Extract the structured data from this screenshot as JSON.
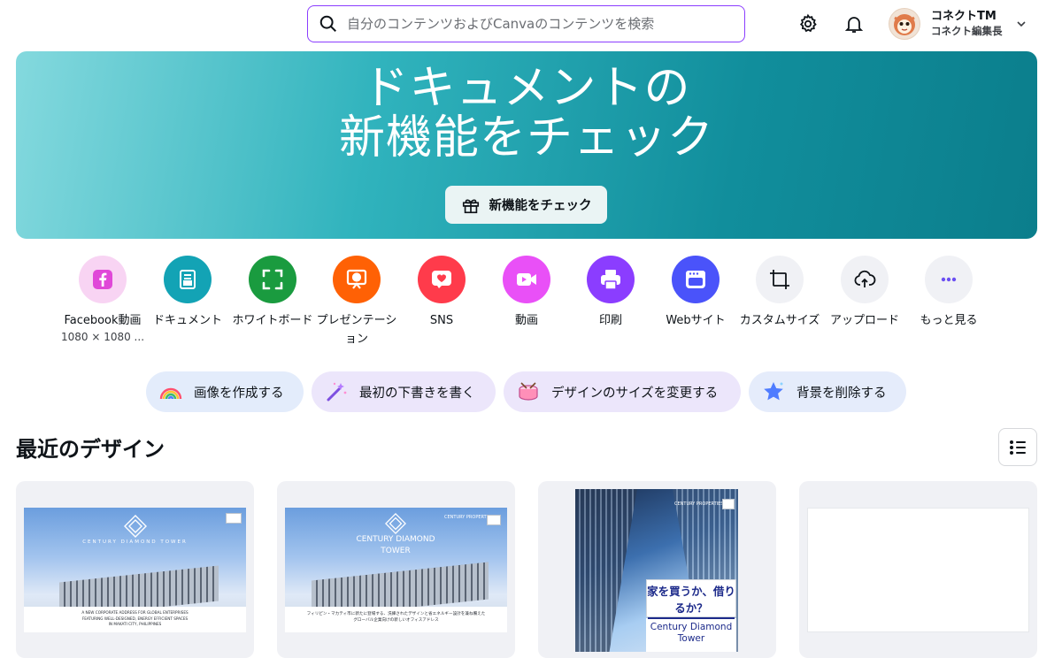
{
  "search": {
    "placeholder": "自分のコンテンツおよびCanvaのコンテンツを検索"
  },
  "account": {
    "name": "コネクトTM",
    "role": "コネクト編集長"
  },
  "banner": {
    "title_line1": "ドキュメントの",
    "title_line2": "新機能をチェック",
    "button_label": "新機能をチェック"
  },
  "shortcuts": [
    {
      "label": "Facebook動画",
      "sub": "1080 × 1080 ...",
      "icon": "facebook-icon",
      "color": "#f5d3f4"
    },
    {
      "label": "ドキュメント",
      "icon": "document-icon",
      "color": "#13a3b5"
    },
    {
      "label": "ホワイトボード",
      "icon": "whiteboard-icon",
      "color": "#1a9b3f"
    },
    {
      "label": "プレゼンテーション",
      "icon": "presentation-icon",
      "color": "#ff6105"
    },
    {
      "label": "SNS",
      "icon": "heart-icon",
      "color": "#ff3b4b"
    },
    {
      "label": "動画",
      "icon": "video-icon",
      "color": "#e950f7"
    },
    {
      "label": "印刷",
      "icon": "printer-icon",
      "color": "#8b3dff"
    },
    {
      "label": "Webサイト",
      "icon": "website-icon",
      "color": "#4a53fa"
    },
    {
      "label": "カスタムサイズ",
      "icon": "custom-size-icon",
      "color": "#f0f1f5"
    },
    {
      "label": "アップロード",
      "icon": "upload-cloud-icon",
      "color": "#f0f1f5"
    },
    {
      "label": "もっと見る",
      "icon": "more-icon",
      "color": "#f0f1f5"
    }
  ],
  "pills": [
    {
      "label": "画像を作成する",
      "icon": "rainbow-icon",
      "color": "#e3ecfb"
    },
    {
      "label": "最初の下書きを書く",
      "icon": "magic-wand-icon",
      "color": "#ece6fb"
    },
    {
      "label": "デザインのサイズを変更する",
      "icon": "drum-icon",
      "color": "#ece6fb"
    },
    {
      "label": "背景を削除する",
      "icon": "star-icon",
      "color": "#e5ecfb"
    }
  ],
  "recent": {
    "title": "最近のデザイン",
    "designs": [
      {
        "name": "CENTURY DIAMOND TOWER",
        "caption": "A NEW CORPORATE ADDRESS FOR GLOBAL ENTERPRISES\nFEATURING WELL-DESIGNED, ENERGY EFFICIENT SPACES\nIN MAKATI CITY, PHILIPPINES"
      },
      {
        "name": "CENTURY DIAMOND TOWER",
        "caption": "フィリピン・マカティ市に新たに登場する、洗練されたデザインと省エネルギー設計を兼ね備えた\nグローバル企業向けの新しいオフィスアドレス",
        "logo": "CENTURY PROPERTIES"
      },
      {
        "name": "Century Diamond Tower",
        "headline": "家を買うか、借りるか？",
        "logo": "CENTURY PROPERTIES"
      },
      {
        "name": ""
      }
    ]
  }
}
